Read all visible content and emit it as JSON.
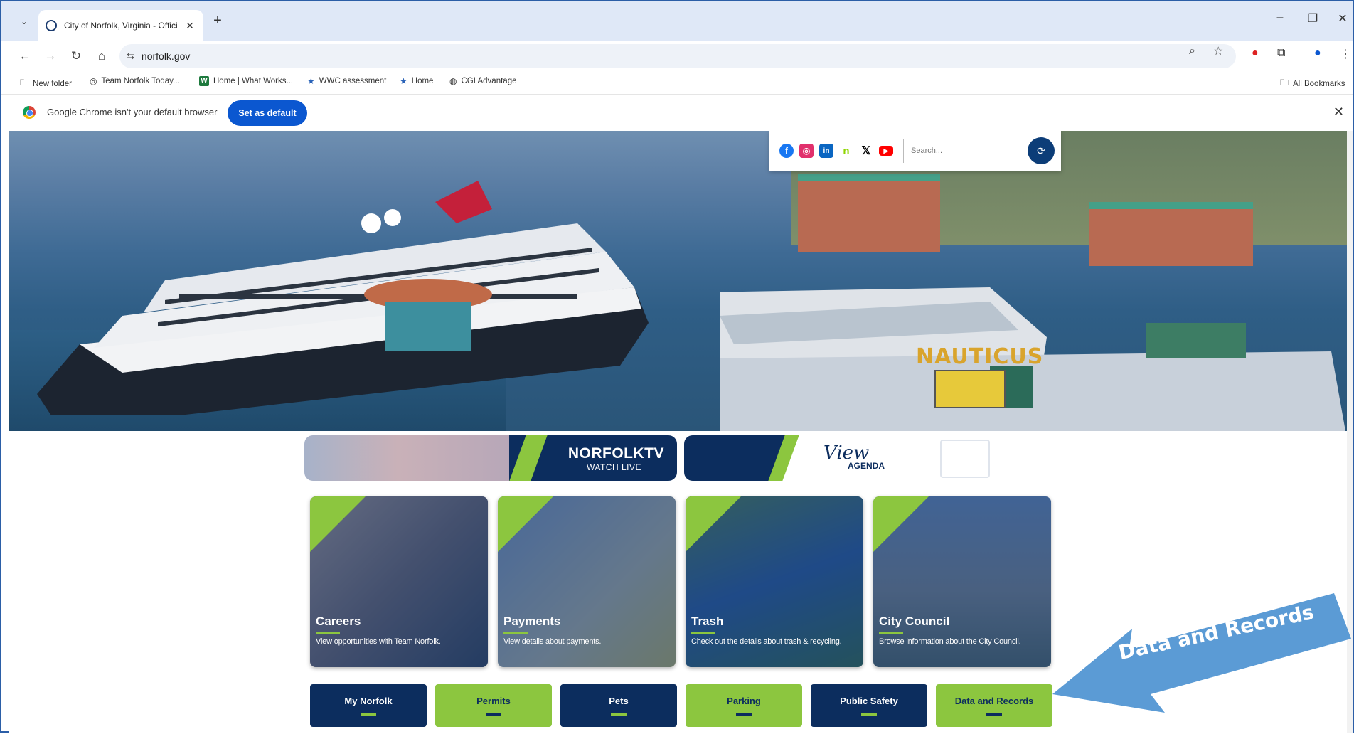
{
  "browser": {
    "tab_title": "City of Norfolk, Virginia - Offici",
    "url": "norfolk.gov",
    "bookmarks": [
      {
        "label": "New folder",
        "icon": "folder-icon"
      },
      {
        "label": "Team Norfolk Today...",
        "icon": "norfolk-seal-icon"
      },
      {
        "label": "Home | What Works...",
        "icon": "w-icon"
      },
      {
        "label": "WWC assessment",
        "icon": "star-icon"
      },
      {
        "label": "Home",
        "icon": "star-icon"
      },
      {
        "label": "CGI Advantage",
        "icon": "globe-icon"
      }
    ],
    "all_bookmarks": "All Bookmarks",
    "infobar_text": "Google Chrome isn't your default browser",
    "set_default_label": "Set as default"
  },
  "header": {
    "social": [
      {
        "name": "facebook",
        "glyph": "f",
        "color": "#1877f2"
      },
      {
        "name": "instagram",
        "glyph": "◎",
        "color": "#e1306c"
      },
      {
        "name": "linkedin",
        "glyph": "in",
        "color": "#0a66c2"
      },
      {
        "name": "nextdoor",
        "glyph": "n",
        "color": "#8ed500"
      },
      {
        "name": "x",
        "glyph": "𝕏",
        "color": "#000000"
      },
      {
        "name": "youtube",
        "glyph": "▶",
        "color": "#ff0000"
      }
    ],
    "search_placeholder": "Search..."
  },
  "hero": {
    "sign_text": "NAUTICUS"
  },
  "banners": {
    "tv_title": "NORFOLKTV",
    "tv_subtitle": "WATCH LIVE",
    "agenda_script": "View",
    "agenda_label": "AGENDA"
  },
  "cards": [
    {
      "title": "Careers",
      "description": "View opportunities with Team Norfolk."
    },
    {
      "title": "Payments",
      "description": "View details about payments."
    },
    {
      "title": "Trash",
      "description": "Check out the details about trash & recycling."
    },
    {
      "title": "City Council",
      "description": "Browse information about the City Council."
    }
  ],
  "quick_links": [
    {
      "label": "My Norfolk",
      "style": "navy"
    },
    {
      "label": "Permits",
      "style": "green"
    },
    {
      "label": "Pets",
      "style": "navy"
    },
    {
      "label": "Parking",
      "style": "green"
    },
    {
      "label": "Public Safety",
      "style": "navy"
    },
    {
      "label": "Data and Records",
      "style": "green"
    }
  ],
  "annotation": {
    "label": "Data and Records"
  },
  "colors": {
    "navy": "#0c2d5e",
    "green": "#8cc63f",
    "chrome_blue": "#0b57d0",
    "arrow_blue": "#5b9bd5"
  }
}
